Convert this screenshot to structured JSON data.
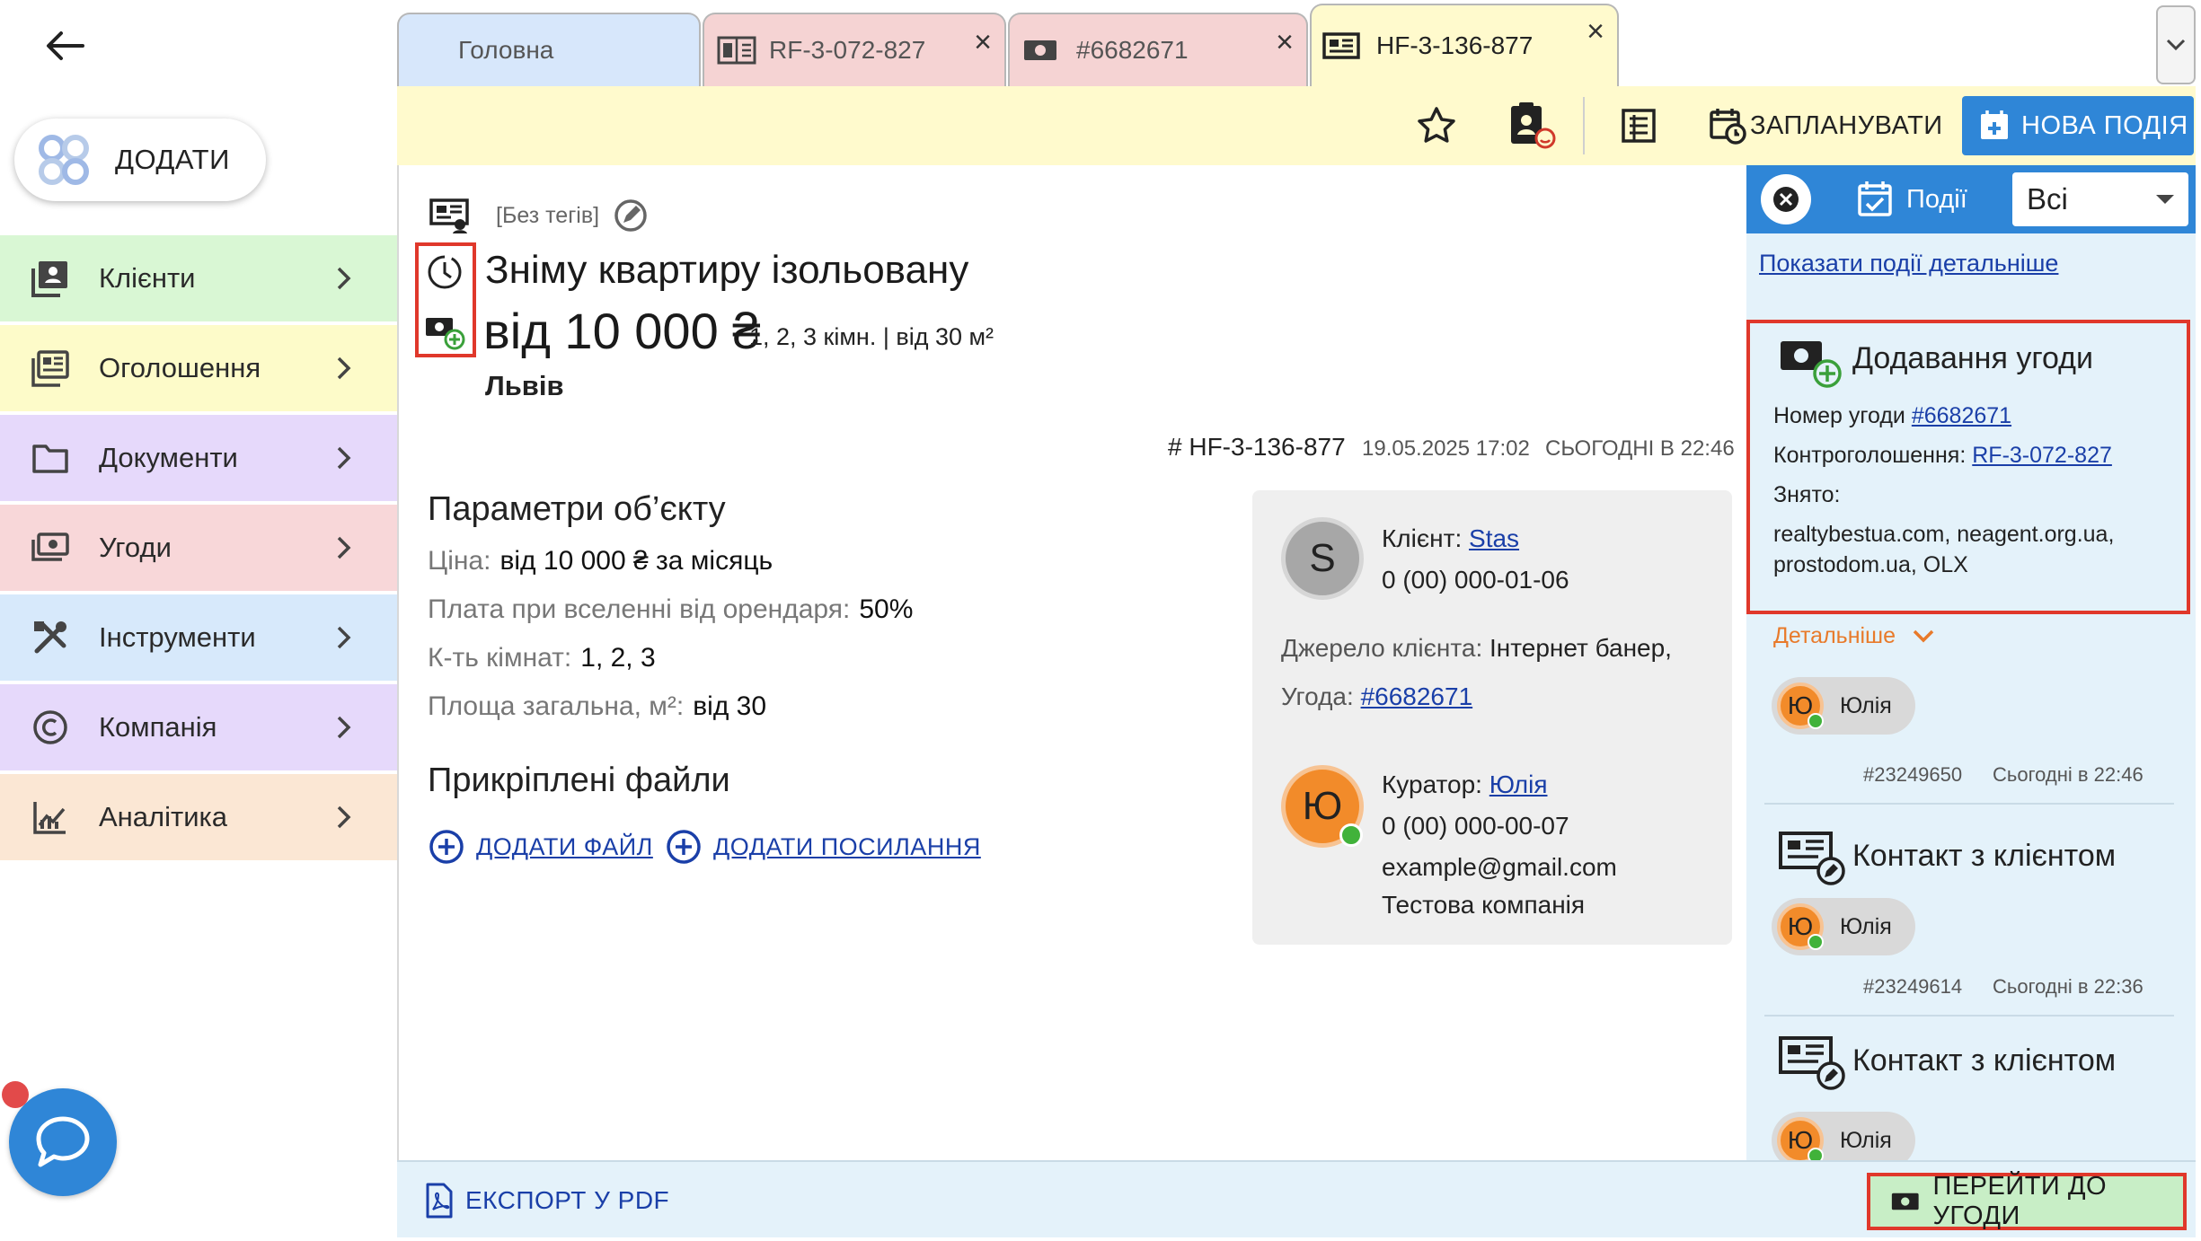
{
  "sidebar": {
    "add_label": "ДОДАТИ",
    "items": [
      {
        "label": "Клієнти",
        "color": "#d9f7d4",
        "icon": "clients-icon"
      },
      {
        "label": "Оголошення",
        "color": "#fdfbc9",
        "icon": "listings-icon"
      },
      {
        "label": "Документи",
        "color": "#e6d9fb",
        "icon": "folder-icon"
      },
      {
        "label": "Угоди",
        "color": "#f8d7d9",
        "icon": "deal-icon"
      },
      {
        "label": "Інструменти",
        "color": "#d7e9fb",
        "icon": "tools-icon"
      },
      {
        "label": "Компанія",
        "color": "#e6d9fb",
        "icon": "copyright-icon"
      },
      {
        "label": "Аналітика",
        "color": "#fbe7d4",
        "icon": "analytics-icon"
      }
    ]
  },
  "tabs": [
    {
      "label": "Головна",
      "color": "#d7e7fb"
    },
    {
      "label": "RF-3-072-827",
      "color": "#f5d3d3"
    },
    {
      "label": "#6682671",
      "color": "#f5d3d3"
    },
    {
      "label": "HF-3-136-877",
      "color": "#fffacd"
    }
  ],
  "toolbar": {
    "schedule_label": "ЗАПЛАНУВАТИ",
    "new_event_label": "НОВА ПОДІЯ"
  },
  "request": {
    "tags": "[Без тегів]",
    "title_line1": "Зніму квартиру ізольовану",
    "title_line2": "від 10 000 ₴",
    "subtitle": "1, 2, 3 кімн. | від 30 м²",
    "city": "Львів",
    "code": "# HF-3-136-877",
    "created": "19.05.2025 17:02",
    "updated": "СЬОГОДНІ В 22:46"
  },
  "params": {
    "heading": "Параметри об’єкту",
    "rows": [
      {
        "label": "Ціна:",
        "value": "від 10 000 ₴ за місяць"
      },
      {
        "label": "Плата при вселенні від орендаря:",
        "value": "50%"
      },
      {
        "label": "К-ть кімнат:",
        "value": "1, 2, 3"
      },
      {
        "label": "Площа загальна, м²:",
        "value": "від 30"
      }
    ]
  },
  "files": {
    "heading": "Прикріплені файли",
    "add_file": "ДОДАТИ ФАЙЛ",
    "add_link": "ДОДАТИ ПОСИЛАННЯ"
  },
  "client": {
    "avatar_letter": "S",
    "label": "Клієнт:",
    "name": "Stas",
    "phone": "0 (00) 000-01-06",
    "source_label": "Джерело клієнта:",
    "source": "Інтернет банер,",
    "deal_label": "Угода:",
    "deal": "#6682671",
    "curator_letter": "Ю",
    "curator_label": "Куратор:",
    "curator": "Юлія",
    "curator_phone": "0 (00) 000-00-07",
    "curator_email": "example@gmail.com",
    "curator_company": "Тестова компанія"
  },
  "events_panel": {
    "title": "Події",
    "filter": "Всі",
    "details_link": "Показати події детальніше",
    "highlight": {
      "title": "Додавання угоди",
      "deal_label": "Номер угоди",
      "deal": "#6682671",
      "counter_label": "Контроголошення:",
      "counter": "RF-3-072-827",
      "taken_label": "Знято:",
      "taken": "realtybestua.com, neagent.org.ua, prostodom.ua, OLX"
    },
    "more": "Детальніше",
    "user_letter": "Ю",
    "user_name": "Юлія",
    "events": [
      {
        "id": "#23249650",
        "time": "Сьогодні в 22:46"
      },
      {
        "title": "Контакт з клієнтом",
        "id": "#23249614",
        "time": "Сьогодні в 22:36"
      },
      {
        "title": "Контакт з клієнтом"
      }
    ]
  },
  "footer": {
    "export": "ЕКСПОРТ У PDF",
    "goto_deal": "ПЕРЕЙТИ ДО УГОДИ"
  }
}
